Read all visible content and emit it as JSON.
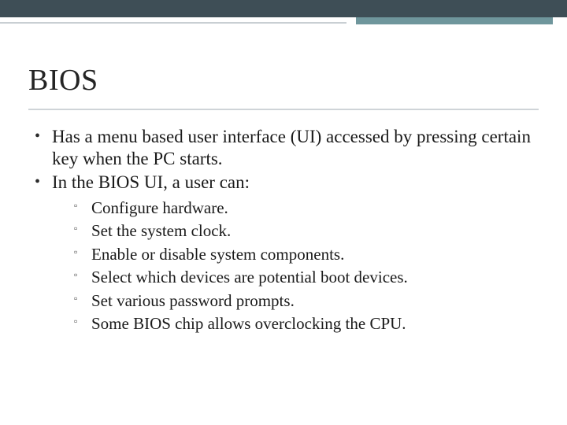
{
  "title": "BIOS",
  "bullets": [
    "Has a menu based user interface (UI) accessed by pressing certain key when the PC starts.",
    "In the BIOS UI, a user can:"
  ],
  "sub_bullets": [
    "Configure hardware.",
    "Set the system clock.",
    "Enable or disable system components.",
    "Select which devices are potential boot devices.",
    "Set various password prompts.",
    "Some BIOS chip allows overclocking the CPU."
  ]
}
